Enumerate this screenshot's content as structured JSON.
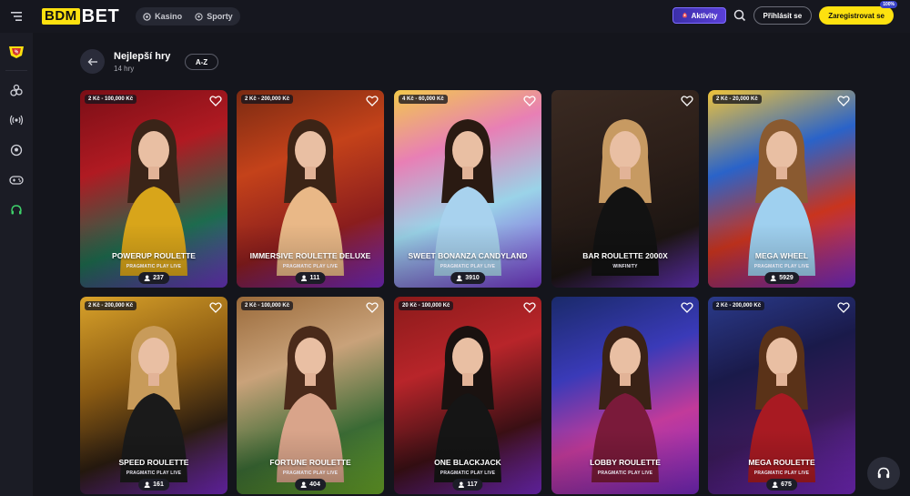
{
  "header": {
    "logo_left": "BDM",
    "logo_right": "BET",
    "switch": {
      "casino_label": "Kasino",
      "sports_label": "Sporty"
    },
    "activity_label": "Aktivity",
    "login_label": "Přihlásit se",
    "register_label": "Zaregistrovat se",
    "register_badge": "100%"
  },
  "sidebar": {
    "items": [
      "home-icon",
      "promo-icon",
      "casino-icon",
      "live-icon",
      "sports-icon",
      "games-icon",
      "support-headset-icon"
    ]
  },
  "page": {
    "title": "Nejlepší hry",
    "subtitle": "14 hry",
    "sort_label": "A-Z"
  },
  "colors": {
    "accent_yellow": "#fde10f",
    "purple": "#6a2bd1",
    "bg": "#14151c"
  },
  "games": [
    {
      "limit": "2 Kč - 100,000 Kč",
      "name": "POWERUP ROULETTE",
      "provider": "PRAGMATIC PLAY LIVE",
      "players": "237",
      "bg": "linear-gradient(160deg,#7a0e16 0%,#b01a22 35%,#1d6b4e 70%,#6f35c8 100%)",
      "dress": "#d8a51a",
      "hair": "#3a2418"
    },
    {
      "limit": "2 Kč - 200,000 Kč",
      "name": "IMMERSIVE ROULETTE DELUXE",
      "provider": "PRAGMATIC PLAY LIVE",
      "players": "111",
      "bg": "linear-gradient(160deg,#7a2a12 0%,#c4421a 35%,#8a1d1d 70%,#7a2ac8 100%)",
      "dress": "#e9b887",
      "hair": "#3c2416"
    },
    {
      "limit": "4 Kč - 60,000 Kč",
      "name": "SWEET BONANZA CANDYLAND",
      "provider": "PRAGMATIC PLAY LIVE",
      "players": "3910",
      "bg": "linear-gradient(160deg,#f2c94c 0%,#e87fb5 30%,#9ad3e8 60%,#7a3ad6 100%)",
      "dress": "#a8d2ee",
      "hair": "#2a1a12"
    },
    {
      "limit": "",
      "name": "BAR ROULETTE 2000X",
      "provider": "WINFINITY",
      "players": "",
      "bg": "linear-gradient(160deg,#3a2a22 0%,#2b1e18 45%,#1c1512 75%,#6a34c4 100%)",
      "dress": "#121212",
      "hair": "#c79a62"
    },
    {
      "limit": "2 Kč - 20,000 Kč",
      "name": "MEGA WHEEL",
      "provider": "PRAGMATIC PLAY LIVE",
      "players": "5929",
      "bg": "linear-gradient(160deg,#f0c43a 0%,#2a63c9 35%,#c9341e 65%,#7b2cd0 100%)",
      "dress": "#9fd0ef",
      "hair": "#8a5a30"
    },
    {
      "limit": "2 Kč - 200,000 Kč",
      "name": "SPEED ROULETTE",
      "provider": "PRAGMATIC PLAY LIVE",
      "players": "161",
      "bg": "linear-gradient(160deg,#d9a22a 0%,#8a5a12 40%,#2a1c10 70%,#7a2ac8 100%)",
      "dress": "#1a1a1a",
      "hair": "#c89b5a"
    },
    {
      "limit": "2 Kč - 100,000 Kč",
      "name": "FORTUNE ROULETTE",
      "provider": "PRAGMATIC PLAY LIVE",
      "players": "404",
      "bg": "linear-gradient(160deg,#9a6a3a 0%,#c9a27a 35%,#3a6a34 70%,#6fae2a 100%)",
      "dress": "#d9a48a",
      "hair": "#4a2a1a"
    },
    {
      "limit": "20 Kč - 100,000 Kč",
      "name": "ONE BLACKJACK",
      "provider": "PRAGMATIC PLAY LIVE",
      "players": "117",
      "bg": "linear-gradient(160deg,#8a1a1a 0%,#b8252a 35%,#3a0f14 70%,#7a2ac8 100%)",
      "dress": "#151515",
      "hair": "#1a1210"
    },
    {
      "limit": "",
      "name": "LOBBY ROULETTE",
      "provider": "PRAGMATIC PLAY LIVE",
      "players": "",
      "bg": "linear-gradient(160deg,#1a2a6a 0%,#3a3ab8 35%,#c23a9a 65%,#7a2ac8 100%)",
      "dress": "#7a1a3a",
      "hair": "#3a2216"
    },
    {
      "limit": "2 Kč - 200,000 Kč",
      "name": "MEGA ROULETTE",
      "provider": "PRAGMATIC PLAY LIVE",
      "players": "675",
      "bg": "linear-gradient(160deg,#2a3a8a 0%,#1a1a4a 35%,#3a1a5a 65%,#7a2ac8 100%)",
      "dress": "#a81a22",
      "hair": "#5a3218"
    }
  ]
}
